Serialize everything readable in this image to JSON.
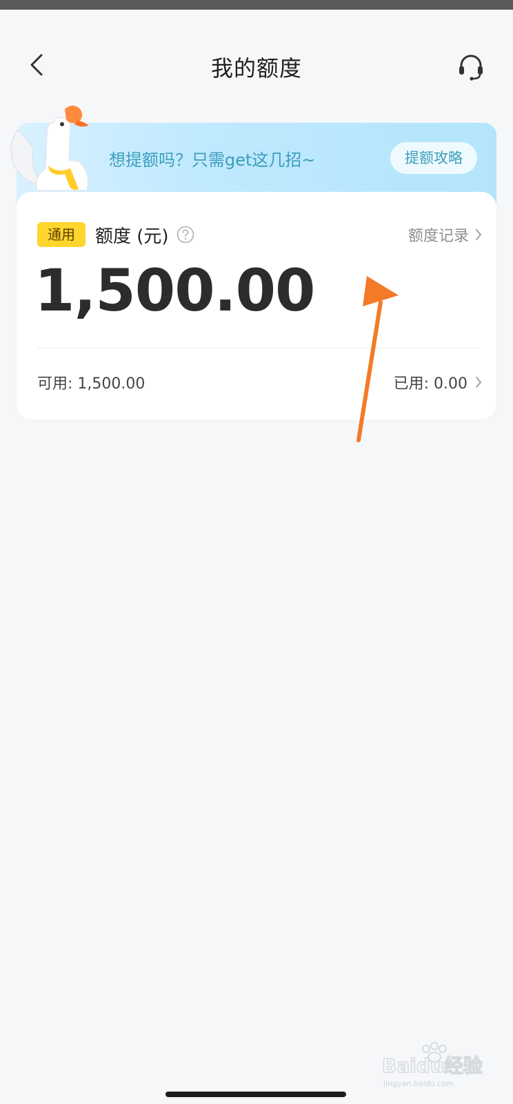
{
  "header": {
    "title": "我的额度"
  },
  "promo": {
    "text": "想提额吗？只需get这几招~",
    "button_label": "提额攻略"
  },
  "quota": {
    "badge": "通用",
    "label": "额度 (元)",
    "record_link": "额度记录",
    "amount": "1,500.00",
    "available": "可用: 1,500.00",
    "used": "已用: 0.00"
  },
  "watermark": {
    "text": "Baidu经验",
    "subtext": "jingyan.baidu.com"
  },
  "colors": {
    "accent_badge": "#ffd52e",
    "promo_text": "#3a9dbb",
    "annotation_arrow": "#f47a27"
  }
}
